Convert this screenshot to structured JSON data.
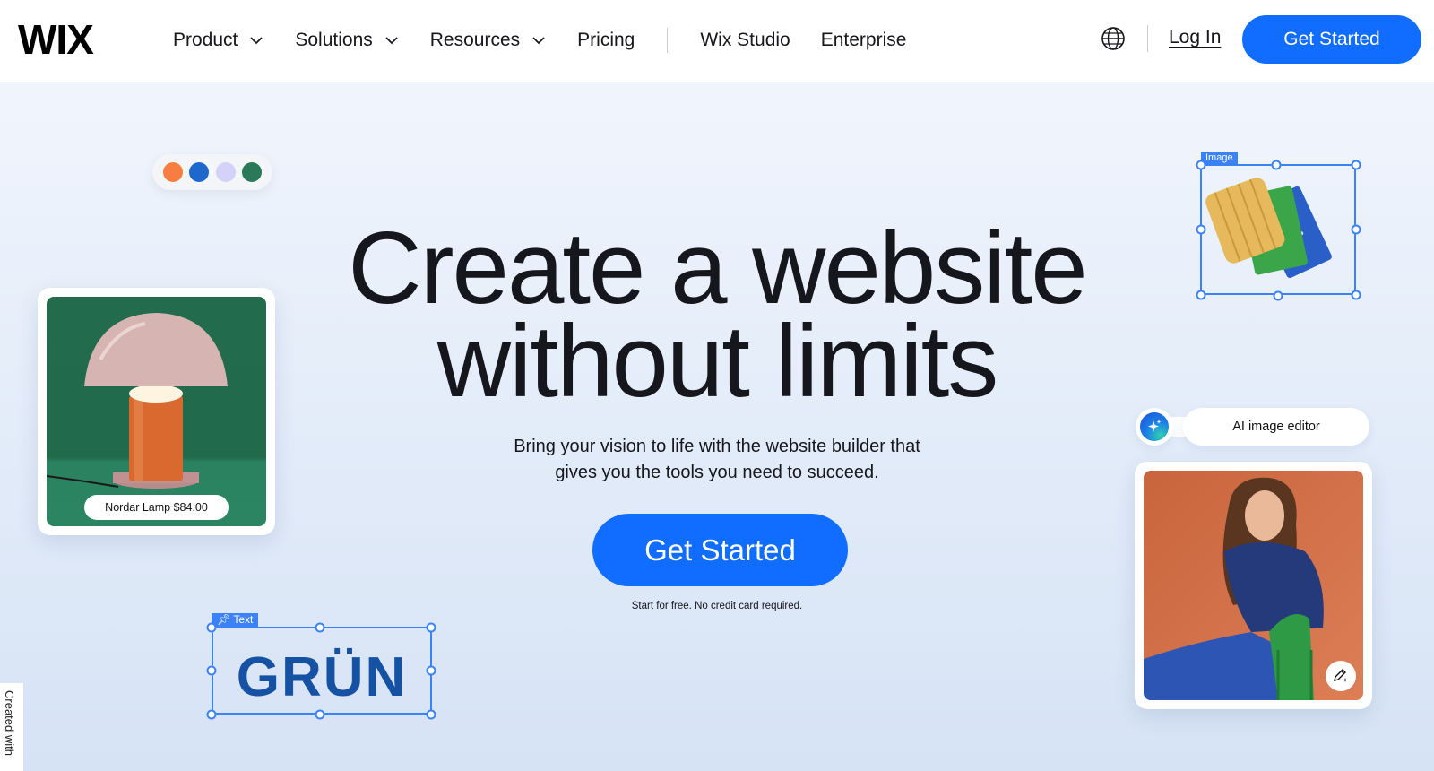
{
  "header": {
    "logo": "WIX",
    "nav": [
      {
        "label": "Product",
        "has_dropdown": true
      },
      {
        "label": "Solutions",
        "has_dropdown": true
      },
      {
        "label": "Resources",
        "has_dropdown": true
      },
      {
        "label": "Pricing",
        "has_dropdown": false
      },
      {
        "label": "Wix Studio",
        "has_dropdown": false
      },
      {
        "label": "Enterprise",
        "has_dropdown": false
      }
    ],
    "language_icon": "globe-icon",
    "login_label": "Log In",
    "cta_label": "Get Started"
  },
  "hero": {
    "title_line1": "Create a website",
    "title_line2": "without limits",
    "subtitle_line1": "Bring your vision to life with the website builder that",
    "subtitle_line2": "gives you the tools you need to succeed.",
    "cta_label": "Get Started",
    "note": "Start for free. No credit card required."
  },
  "decor": {
    "swatches": [
      "#f77e41",
      "#1d67cd",
      "#d4d2f8",
      "#2a7a58"
    ],
    "lamp_card": {
      "tag": "Nordar Lamp $84.00"
    },
    "image_selection": {
      "label": "Image"
    },
    "text_selection": {
      "label": "Text",
      "text": "GRÜN"
    },
    "ai_editor": {
      "label": "AI image editor",
      "icon": "sparkle-icon"
    },
    "edit_icon": "pencil-sparkle-icon"
  },
  "footer_tab": {
    "label": "Created with"
  },
  "colors": {
    "accent": "#116dff",
    "selection": "#3b82f6",
    "text": "#16161d"
  }
}
